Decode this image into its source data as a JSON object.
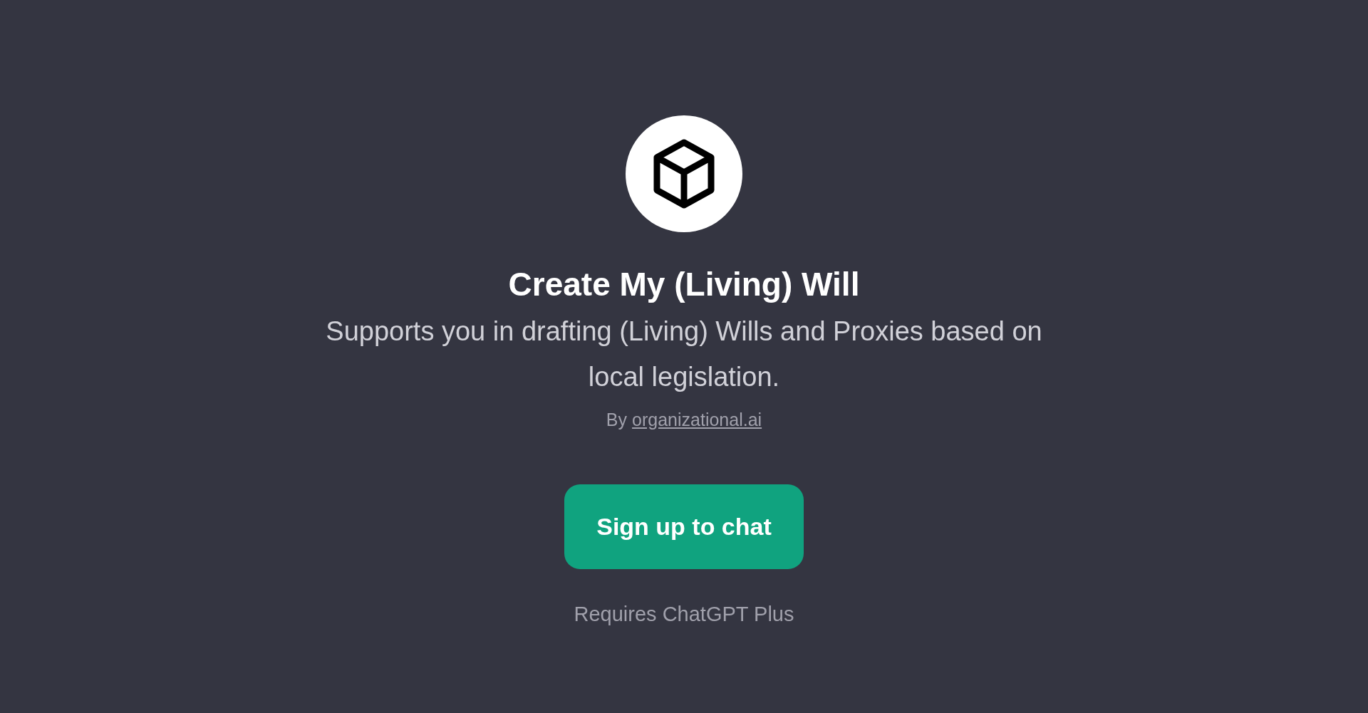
{
  "title": "Create My (Living) Will",
  "description": "Supports you in drafting (Living) Wills and Proxies based on local legislation.",
  "author": {
    "prefix": "By",
    "link": "organizational.ai"
  },
  "button": "Sign up to chat",
  "note": "Requires ChatGPT Plus"
}
